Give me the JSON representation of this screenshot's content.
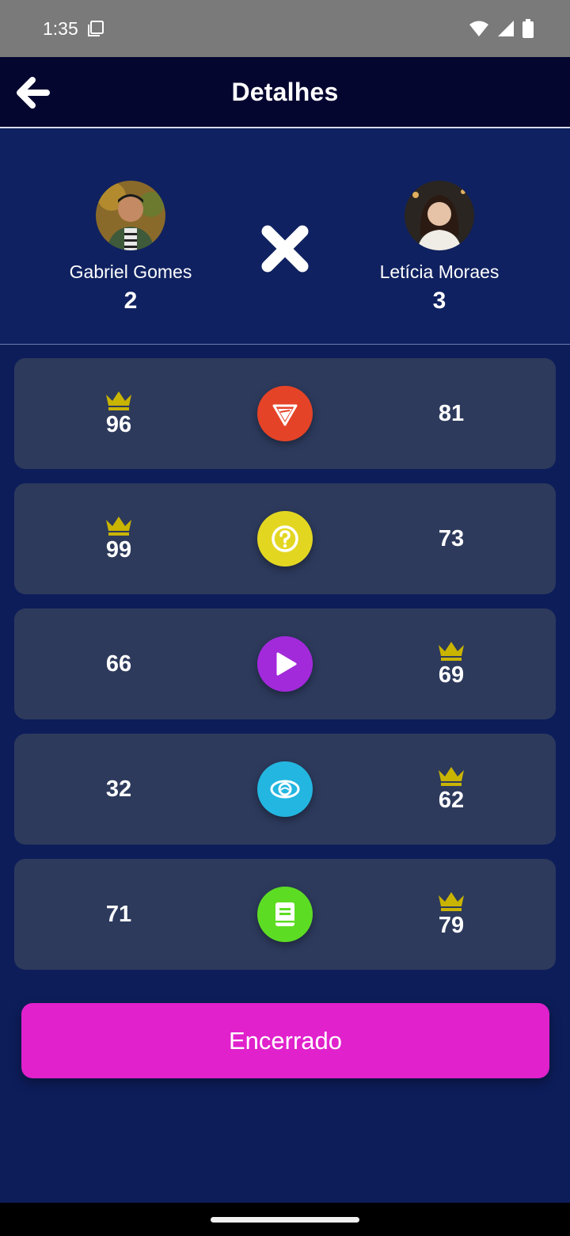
{
  "status_bar": {
    "time": "1:35"
  },
  "app_bar": {
    "title": "Detalhes"
  },
  "players": [
    {
      "name": "Gabriel Gomes",
      "score": "2"
    },
    {
      "name": "Letícia Moraes",
      "score": "3"
    }
  ],
  "rounds": [
    {
      "left": "96",
      "right": "81",
      "winner": "left",
      "category_icon": "pennant-icon",
      "color": "#e54327"
    },
    {
      "left": "99",
      "right": "73",
      "winner": "left",
      "category_icon": "question-icon",
      "color": "#e3d621"
    },
    {
      "left": "66",
      "right": "69",
      "winner": "right",
      "category_icon": "play-icon",
      "color": "#a22adb"
    },
    {
      "left": "32",
      "right": "62",
      "winner": "right",
      "category_icon": "eye-icon",
      "color": "#23b6e0"
    },
    {
      "left": "71",
      "right": "79",
      "winner": "right",
      "category_icon": "book-icon",
      "color": "#5ddc24"
    }
  ],
  "finish_button": {
    "label": "Encerrado"
  },
  "colors": {
    "background": "#0d1d5a",
    "app_bar": "#040630",
    "card": "#2d3a5c",
    "crown": "#c9b400",
    "button": "#e021cc"
  }
}
